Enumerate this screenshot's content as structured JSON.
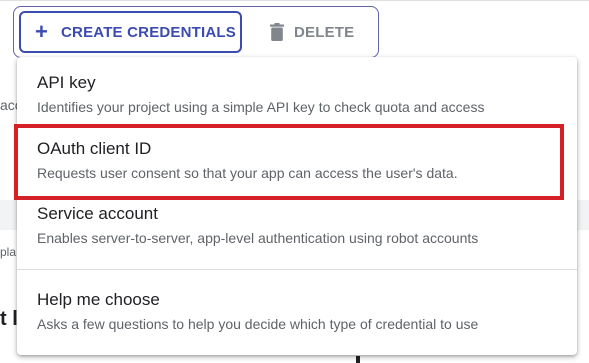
{
  "toolbar": {
    "create_label": "CREATE CREDENTIALS",
    "create_icon": "plus-icon",
    "delete_label": "DELETE",
    "delete_icon": "trash-icon",
    "accent_color": "#3c4bb0"
  },
  "background_fragments": {
    "left_text_1": "acc",
    "left_text_2": "pla",
    "left_heading": "t l"
  },
  "menu": {
    "items": [
      {
        "title": "API key",
        "description": "Identifies your project using a simple API key to check quota and access"
      },
      {
        "title": "OAuth client ID",
        "description": "Requests user consent so that your app can access the user's data."
      },
      {
        "title": "Service account",
        "description": "Enables server-to-server, app-level authentication using robot accounts"
      },
      {
        "title": "Help me choose",
        "description": "Asks a few questions to help you decide which type of credential to use"
      }
    ],
    "highlighted_item": "OAuth client ID",
    "highlight_color": "#d42027"
  }
}
